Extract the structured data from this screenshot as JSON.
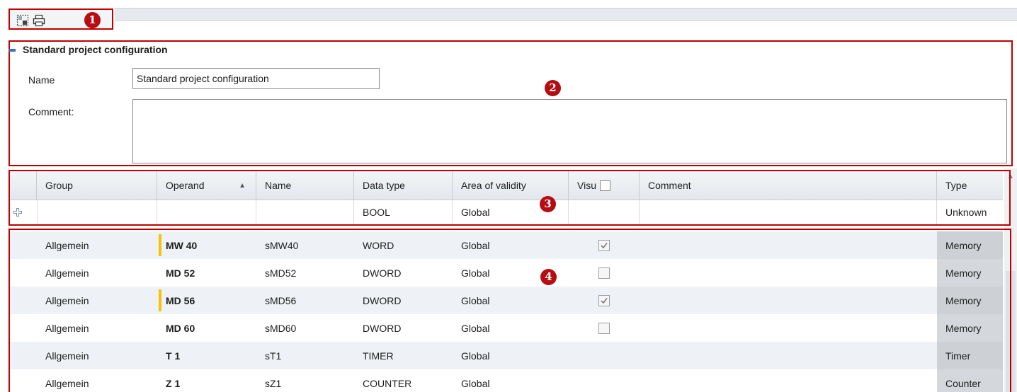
{
  "toolbar": {
    "marker": "1",
    "buttons": [
      {
        "icon": "select-area-icon"
      },
      {
        "icon": "print-icon"
      }
    ]
  },
  "section": {
    "marker": "2",
    "title": "Standard project configuration",
    "name_label": "Name",
    "name_value": "Standard project configuration",
    "comment_label": "Comment:",
    "comment_value": ""
  },
  "grid": {
    "header_marker": "3",
    "body_marker": "4",
    "columns": {
      "group": "Group",
      "operand": "Operand",
      "name": "Name",
      "data_type": "Data type",
      "area": "Area of validity",
      "visu": "Visu",
      "comment": "Comment",
      "type": "Type"
    },
    "sort_indicator": "▲",
    "new_row": {
      "data_type": "BOOL",
      "area": "Global",
      "type": "Unknown"
    },
    "rows": [
      {
        "group": "Allgemein",
        "operand": "MW 40",
        "name": "sMW40",
        "data_type": "WORD",
        "area": "Global",
        "visu": true,
        "has_visu": true,
        "marked": true,
        "type": "Memory"
      },
      {
        "group": "Allgemein",
        "operand": "MD 52",
        "name": "sMD52",
        "data_type": "DWORD",
        "area": "Global",
        "visu": false,
        "has_visu": true,
        "marked": false,
        "type": "Memory"
      },
      {
        "group": "Allgemein",
        "operand": "MD 56",
        "name": "sMD56",
        "data_type": "DWORD",
        "area": "Global",
        "visu": true,
        "has_visu": true,
        "marked": true,
        "type": "Memory"
      },
      {
        "group": "Allgemein",
        "operand": "MD 60",
        "name": "sMD60",
        "data_type": "DWORD",
        "area": "Global",
        "visu": false,
        "has_visu": true,
        "marked": false,
        "type": "Memory"
      },
      {
        "group": "Allgemein",
        "operand": "T 1",
        "name": "sT1",
        "data_type": "TIMER",
        "area": "Global",
        "visu": false,
        "has_visu": false,
        "marked": false,
        "type": "Timer"
      },
      {
        "group": "Allgemein",
        "operand": "Z 1",
        "name": "sZ1",
        "data_type": "COUNTER",
        "area": "Global",
        "visu": false,
        "has_visu": false,
        "marked": false,
        "type": "Counter"
      }
    ]
  },
  "colors": {
    "highlight_border": "#c00000",
    "marker_fill": "#b50d12",
    "modified_marker": "#f5c400"
  }
}
